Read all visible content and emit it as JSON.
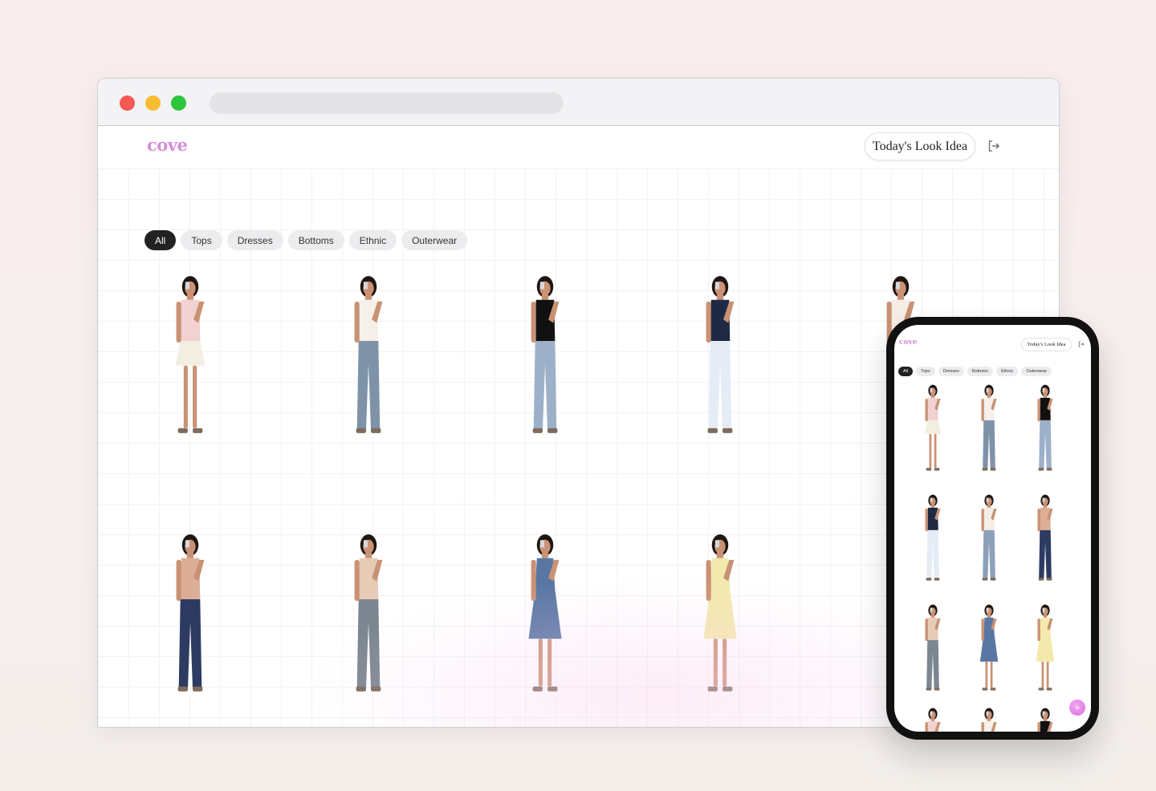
{
  "app": {
    "logo": "cove"
  },
  "header": {
    "look_button": "Today's Look Idea"
  },
  "filters": [
    {
      "label": "All",
      "active": true
    },
    {
      "label": "Tops",
      "active": false
    },
    {
      "label": "Dresses",
      "active": false
    },
    {
      "label": "Bottoms",
      "active": false
    },
    {
      "label": "Ethnic",
      "active": false
    },
    {
      "label": "Outerwear",
      "active": false
    }
  ],
  "outfits": [
    {
      "top": "#f1d1d1",
      "bottom": "#f2efe2",
      "bottom_type": "skirt"
    },
    {
      "top": "#f5f1ea",
      "bottom": "#7f93a8",
      "bottom_type": "jeans"
    },
    {
      "top": "#111111",
      "bottom": "#9db0c9",
      "bottom_type": "jeans"
    },
    {
      "top": "#1e2a44",
      "bottom": "#e6ecf5",
      "bottom_type": "jeans"
    },
    {
      "top": "#f4eee6",
      "bottom": "#8da0b8",
      "bottom_type": "jeans"
    },
    {
      "top": "#dcae95",
      "bottom": "#2d3b62",
      "bottom_type": "jeans"
    },
    {
      "top": "#e7cbb6",
      "bottom": "#7b8690",
      "bottom_type": "jeans"
    },
    {
      "top": "#5a77a4",
      "bottom": "#7691bb",
      "bottom_type": "dress"
    },
    {
      "top": "#f3e9ad",
      "bottom": "#f3e9ad",
      "bottom_type": "dress"
    }
  ],
  "colors": {
    "accent": "#d58fd8",
    "chip_active": "#222222",
    "chip_bg": "#ececef"
  },
  "icons": {
    "logout": "logout-icon",
    "add": "plus-icon"
  }
}
